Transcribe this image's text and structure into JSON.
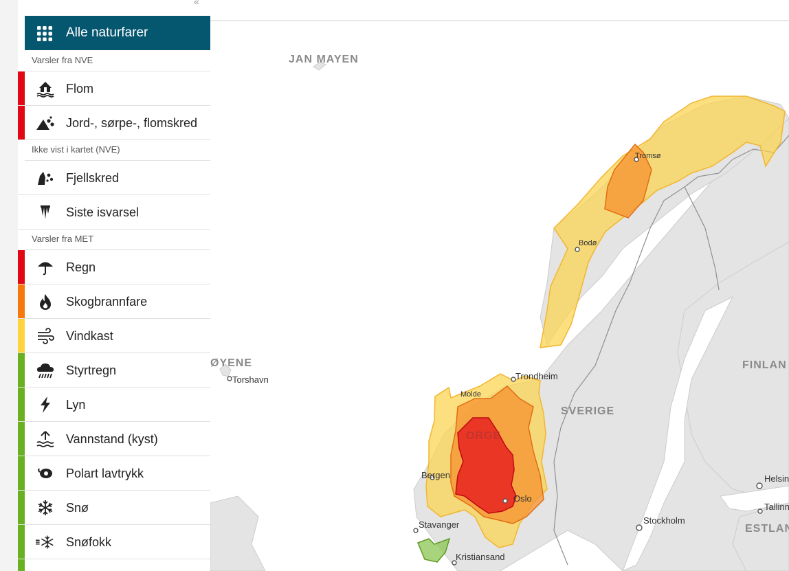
{
  "sidebar": {
    "all_button_label": "Alle naturfarer",
    "groups": [
      "Varsler fra NVE",
      "Ikke vist i kartet (NVE)",
      "Varsler fra MET"
    ],
    "items": [
      {
        "label": "Flom",
        "icon": "house-flood-icon",
        "level_color": "#e30613"
      },
      {
        "label": "Jord-, sørpe-, flomskred",
        "icon": "landslide-icon",
        "level_color": "#e30613"
      },
      {
        "label": "Fjellskred",
        "icon": "rockslide-icon",
        "level_color": ""
      },
      {
        "label": "Siste isvarsel",
        "icon": "icicle-icon",
        "level_color": ""
      },
      {
        "label": "Regn",
        "icon": "umbrella-icon",
        "level_color": "#e30613"
      },
      {
        "label": "Skogbrannfare",
        "icon": "fire-icon",
        "level_color": "#f7790c"
      },
      {
        "label": "Vindkast",
        "icon": "wind-icon",
        "level_color": "#ffd33d"
      },
      {
        "label": "Styrtregn",
        "icon": "heavy-rain-icon",
        "level_color": "#6ab023"
      },
      {
        "label": "Lyn",
        "icon": "lightning-icon",
        "level_color": "#6ab023"
      },
      {
        "label": "Vannstand (kyst)",
        "icon": "water-level-icon",
        "level_color": "#6ab023"
      },
      {
        "label": "Polart lavtrykk",
        "icon": "polar-low-icon",
        "level_color": "#6ab023"
      },
      {
        "label": "Snø",
        "icon": "snowflake-icon",
        "level_color": "#6ab023"
      },
      {
        "label": "Snøfokk",
        "icon": "snowdrift-icon",
        "level_color": "#6ab023"
      }
    ]
  },
  "map": {
    "places": {
      "jan_mayen": "JAN MAYEN",
      "tromso": "Tromsø",
      "bodo": "Bodø",
      "trondheim": "Trondheim",
      "molde": "Molde",
      "bergen": "Bergen",
      "oslo": "Oslo",
      "stavanger": "Stavanger",
      "kristiansand": "Kristiansand",
      "torshavn": "Torshavn",
      "stockholm": "Stockholm",
      "helsinki": "Helsinki",
      "tallinn": "Tallinn"
    },
    "countries": {
      "faroe": "ØYENE",
      "sweden": "SVERIGE",
      "finland": "FINLAN",
      "estonia": "ESTLAN",
      "norway": "ORGE"
    },
    "colors": {
      "red": "#e30613",
      "orange": "#f7790c",
      "yellow": "#ffd33d",
      "green": "#6ab023"
    }
  }
}
